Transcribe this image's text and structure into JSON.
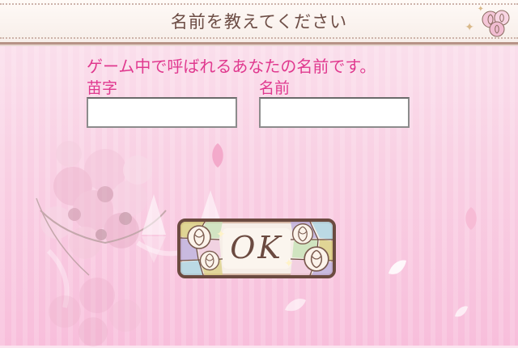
{
  "header": {
    "title": "名前を教えてください"
  },
  "form": {
    "prompt": "ゲーム中で呼ばれるあなたの名前です。",
    "last_name_label": "苗字",
    "first_name_label": "名前",
    "last_name_value": "",
    "first_name_value": ""
  },
  "ok_button": {
    "label": "OK"
  },
  "colors": {
    "prompt_text": "#e0398f",
    "header_text": "#6d4d45",
    "button_frame": "#6b4a40"
  },
  "icons": {
    "header": "rose-icon",
    "button": "rose-icon"
  }
}
